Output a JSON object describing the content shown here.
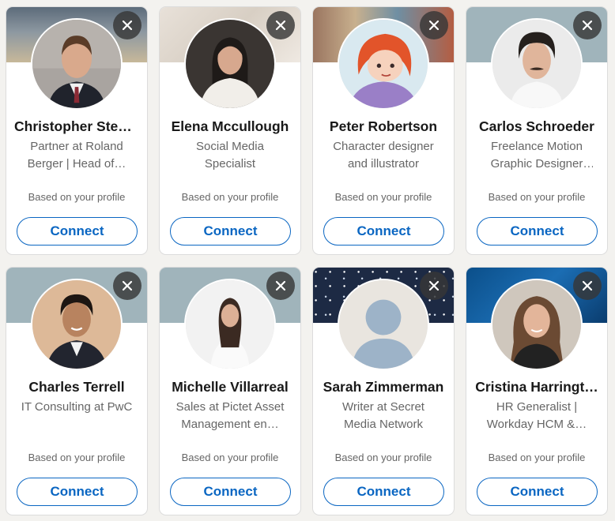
{
  "colors": {
    "accent": "#0a66c2",
    "page_bg": "#f3f2ef"
  },
  "cards": [
    {
      "name": "Christopher Step…",
      "headline": "Partner at Roland Berger | Head of…",
      "reason": "Based on your profile",
      "connect_label": "Connect",
      "banner": "sky",
      "avatar": "man-suit"
    },
    {
      "name": "Elena Mccullough",
      "headline": "Social Media Specialist",
      "reason": "Based on your profile",
      "connect_label": "Connect",
      "banner": "beige",
      "avatar": "woman-white"
    },
    {
      "name": "Peter Robertson",
      "headline": "Character designer and illustrator",
      "reason": "Based on your profile",
      "connect_label": "Connect",
      "banner": "illustration",
      "avatar": "illustration"
    },
    {
      "name": "Carlos Schroeder",
      "headline": "Freelance Motion Graphic Designer en…",
      "reason": "Based on your profile",
      "connect_label": "Connect",
      "banner": "teal",
      "avatar": "man-casual"
    },
    {
      "name": "Charles Terrell",
      "headline": "IT Consulting at PwC",
      "reason": "Based on your profile",
      "connect_label": "Connect",
      "banner": "teal",
      "avatar": "man-suit-dark"
    },
    {
      "name": "Michelle Villarreal",
      "headline": "Sales at Pictet Asset Management en…",
      "reason": "Based on your profile",
      "connect_label": "Connect",
      "banner": "teal",
      "avatar": "woman-light"
    },
    {
      "name": "Sarah Zimmerman",
      "headline": "Writer at Secret Media Network",
      "reason": "Based on your profile",
      "connect_label": "Connect",
      "banner": "stars",
      "avatar": "placeholder"
    },
    {
      "name": "Cristina Harringt…",
      "headline": "HR Generalist | Workday HCM &…",
      "reason": "Based on your profile",
      "connect_label": "Connect",
      "banner": "blue-tech",
      "avatar": "woman-hair"
    }
  ],
  "icons": {
    "dismiss": "close-icon"
  }
}
